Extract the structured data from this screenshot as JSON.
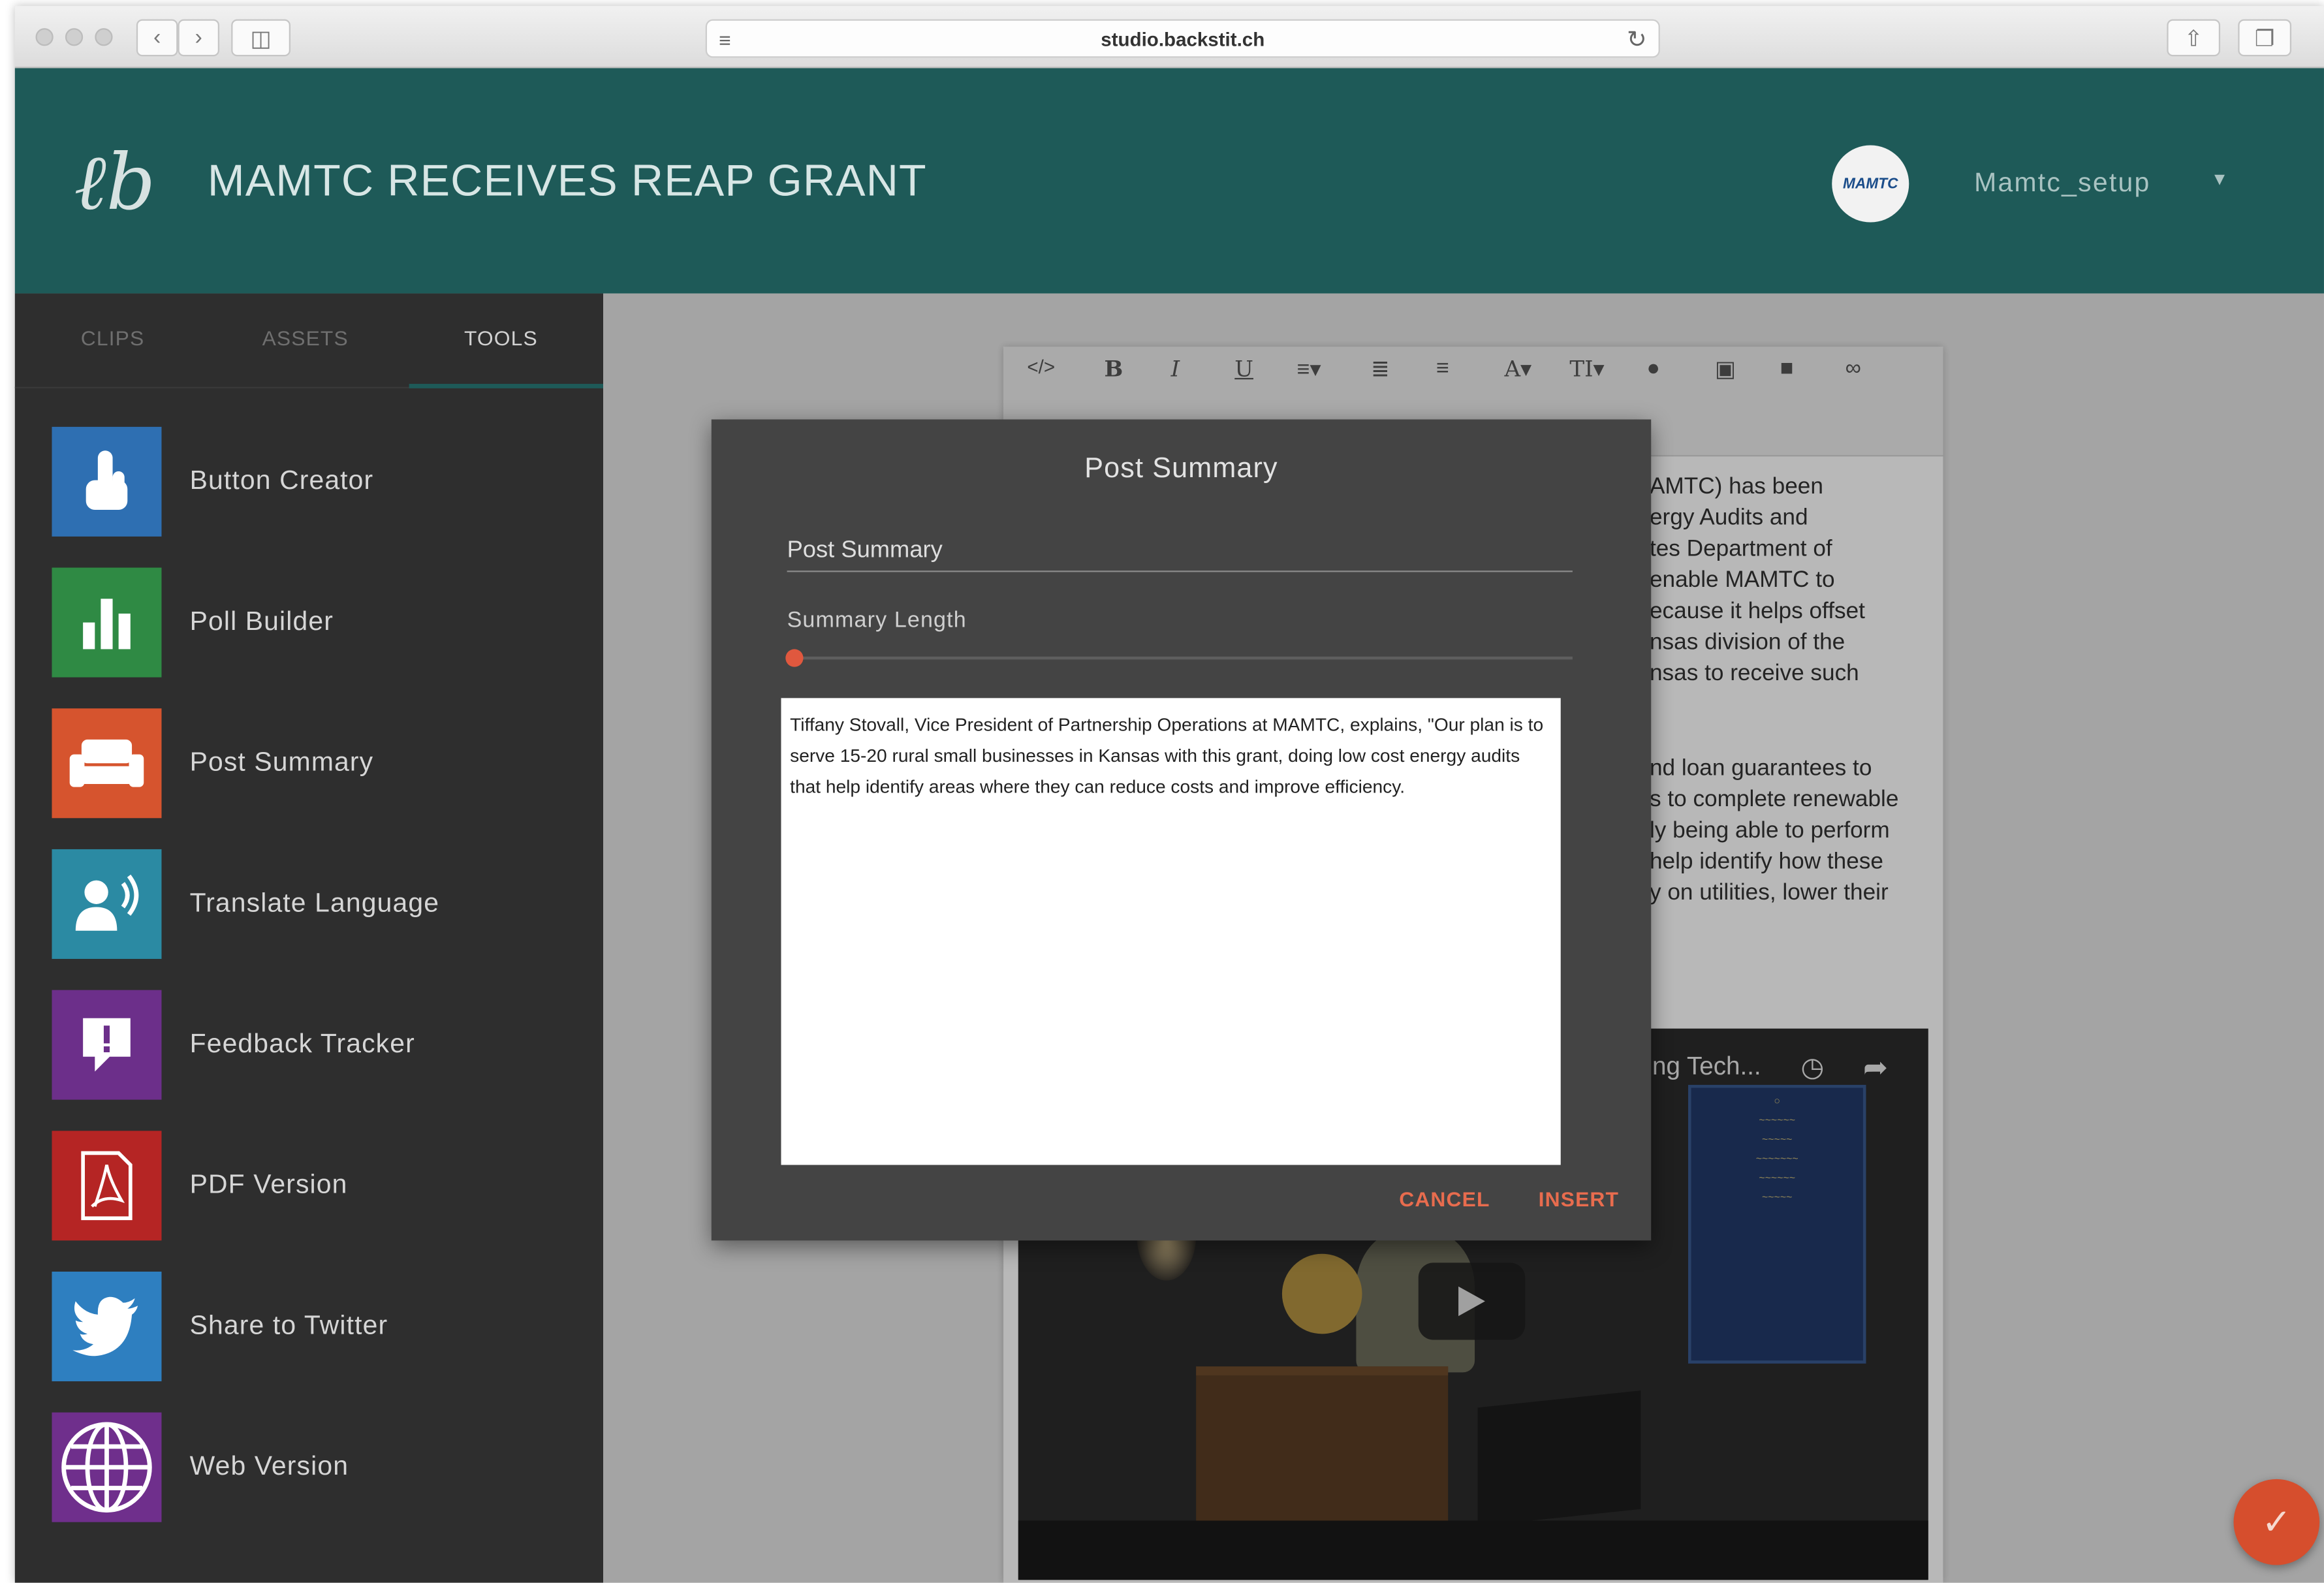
{
  "browser": {
    "url": "studio.backstit.ch"
  },
  "header": {
    "title": "MAMTC RECEIVES REAP GRANT",
    "avatar_text": "MAMTC",
    "username": "Mamtc_setup",
    "accent": "#1e5a58"
  },
  "sidebar": {
    "tabs": [
      {
        "label": "CLIPS"
      },
      {
        "label": "ASSETS"
      },
      {
        "label": "TOOLS",
        "active": true
      }
    ],
    "tools": [
      {
        "label": "Button Creator",
        "icon": "hand-pointer-icon",
        "color": "#2e6fb2"
      },
      {
        "label": "Poll Builder",
        "icon": "bar-chart-icon",
        "color": "#2f8a44"
      },
      {
        "label": "Post Summary",
        "icon": "couch-icon",
        "color": "#d6542e"
      },
      {
        "label": "Translate Language",
        "icon": "speaking-person-icon",
        "color": "#2b8aa3"
      },
      {
        "label": "Feedback Tracker",
        "icon": "alert-speech-bubble-icon",
        "color": "#6c2f8a"
      },
      {
        "label": "PDF Version",
        "icon": "pdf-document-icon",
        "color": "#b52524"
      },
      {
        "label": "Share to Twitter",
        "icon": "twitter-bird-icon",
        "color": "#2e7fc0"
      },
      {
        "label": "Web Version",
        "icon": "globe-icon",
        "color": "#6f2f8c"
      }
    ]
  },
  "editor": {
    "toolbar": [
      "</>",
      "B",
      "I",
      "U",
      "≡▾",
      "ordered-list",
      "bullet-list",
      "A▾",
      "TI▾",
      "color",
      "image",
      "video",
      "link"
    ],
    "visible_lines_1": [
      "AMTC) has been",
      "ergy Audits and",
      "tes Department of",
      "enable MAMTC to",
      "ecause it helps offset",
      "nsas division of the",
      "nsas to receive such"
    ],
    "visible_lines_2": [
      "nd loan guarantees to",
      "s to complete renewable",
      "ly being able to perform",
      "help identify how these",
      "y on utilities, lower their"
    ],
    "video_title": "ing Tech..."
  },
  "modal": {
    "title": "Post Summary",
    "field_value": "Post Summary",
    "slider_label": "Summary Length",
    "slider_value_fraction": 0.01,
    "summary_text": "Tiffany Stovall, Vice President of Partnership Operations at MAMTC, explains, \"Our plan is to serve 15-20 rural small businesses in Kansas with this grant, doing low cost energy audits that help identify areas where they can reduce costs and improve efficiency.",
    "cancel_label": "CANCEL",
    "insert_label": "INSERT",
    "button_color": "#e86c4e"
  },
  "fab": {
    "icon": "checkmark-icon"
  }
}
